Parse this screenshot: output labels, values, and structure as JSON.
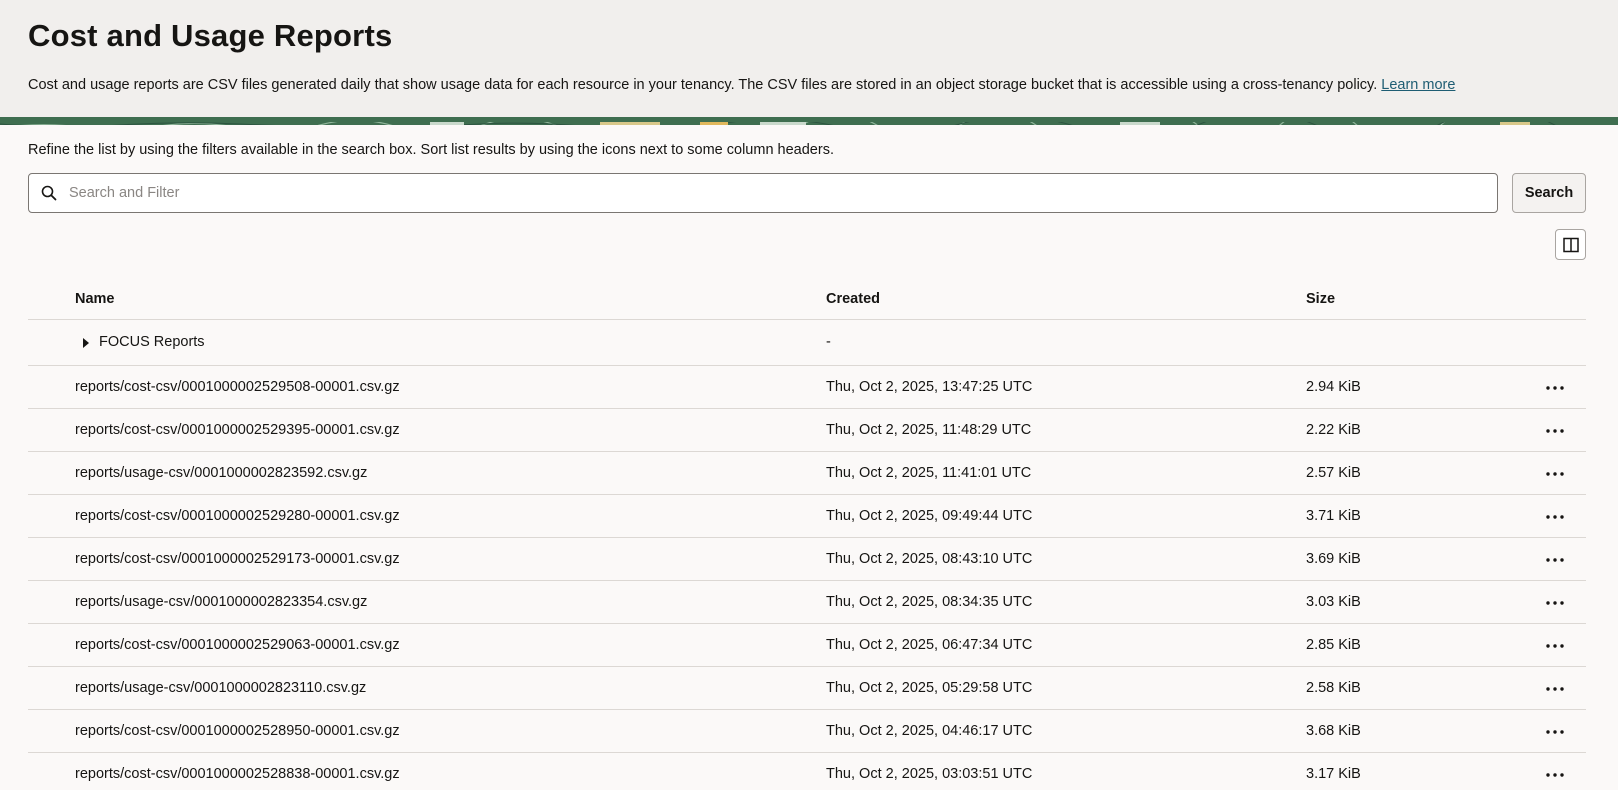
{
  "header": {
    "title": "Cost and Usage Reports",
    "description": "Cost and usage reports are CSV files generated daily that show usage data for each resource in your tenancy. The CSV files are stored in an object storage bucket that is accessible using a cross-tenancy policy.",
    "learn_more": "Learn more"
  },
  "hint": "Refine the list by using the filters available in the search box. Sort list results by using the icons next to some column headers.",
  "search": {
    "placeholder": "Search and Filter",
    "value": "",
    "button_label": "Search",
    "icon": "search-icon"
  },
  "toolbar": {
    "columns_icon": "columns-icon"
  },
  "table": {
    "columns": [
      "Name",
      "Created",
      "Size"
    ],
    "folder": {
      "name": "FOCUS Reports",
      "created": "-",
      "size": ""
    },
    "rows": [
      {
        "name": "reports/cost-csv/0001000002529508-00001.csv.gz",
        "created": "Thu, Oct 2, 2025, 13:47:25 UTC",
        "size": "2.94 KiB"
      },
      {
        "name": "reports/cost-csv/0001000002529395-00001.csv.gz",
        "created": "Thu, Oct 2, 2025, 11:48:29 UTC",
        "size": "2.22 KiB"
      },
      {
        "name": "reports/usage-csv/0001000002823592.csv.gz",
        "created": "Thu, Oct 2, 2025, 11:41:01 UTC",
        "size": "2.57 KiB"
      },
      {
        "name": "reports/cost-csv/0001000002529280-00001.csv.gz",
        "created": "Thu, Oct 2, 2025, 09:49:44 UTC",
        "size": "3.71 KiB"
      },
      {
        "name": "reports/cost-csv/0001000002529173-00001.csv.gz",
        "created": "Thu, Oct 2, 2025, 08:43:10 UTC",
        "size": "3.69 KiB"
      },
      {
        "name": "reports/usage-csv/0001000002823354.csv.gz",
        "created": "Thu, Oct 2, 2025, 08:34:35 UTC",
        "size": "3.03 KiB"
      },
      {
        "name": "reports/cost-csv/0001000002529063-00001.csv.gz",
        "created": "Thu, Oct 2, 2025, 06:47:34 UTC",
        "size": "2.85 KiB"
      },
      {
        "name": "reports/usage-csv/0001000002823110.csv.gz",
        "created": "Thu, Oct 2, 2025, 05:29:58 UTC",
        "size": "2.58 KiB"
      },
      {
        "name": "reports/cost-csv/0001000002528950-00001.csv.gz",
        "created": "Thu, Oct 2, 2025, 04:46:17 UTC",
        "size": "3.68 KiB"
      },
      {
        "name": "reports/cost-csv/0001000002528838-00001.csv.gz",
        "created": "Thu, Oct 2, 2025, 03:03:51 UTC",
        "size": "3.17 KiB"
      }
    ]
  },
  "colors": {
    "header_bg": "#f1efed",
    "page_bg": "#fbf9f8",
    "link": "#1e5d73",
    "banner_green": "#3f6e50"
  }
}
